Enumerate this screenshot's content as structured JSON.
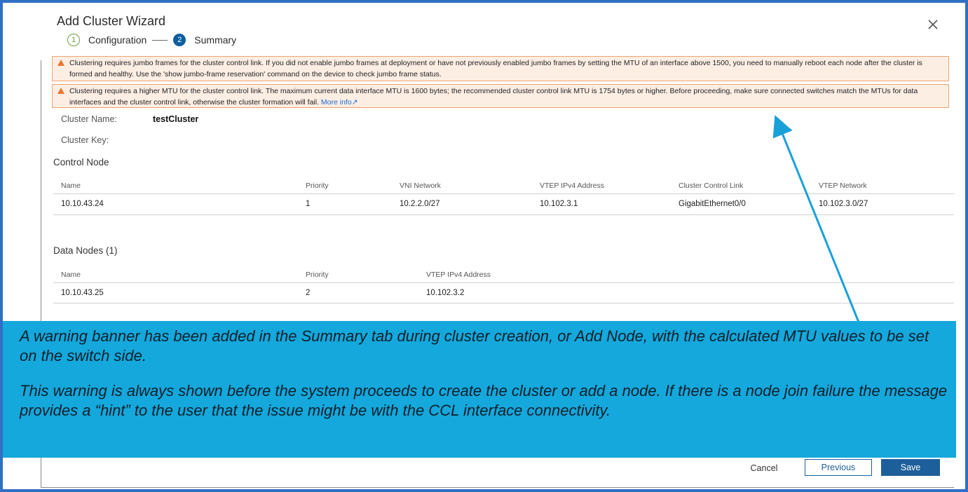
{
  "wizard": {
    "title": "Add Cluster Wizard",
    "steps": [
      {
        "number": "1",
        "label": "Configuration"
      },
      {
        "number": "2",
        "label": "Summary"
      }
    ]
  },
  "warnings": [
    {
      "text": "Clustering requires jumbo frames for the cluster control link. If you did not enable jumbo frames at deployment or have not previously enabled jumbo frames by setting the MTU of an interface above 1500, you need to manually reboot each node after the cluster is formed and healthy. Use the 'show jumbo-frame reservation' command on the device to check jumbo frame status."
    },
    {
      "text": "Clustering requires a higher MTU for the cluster control link. The maximum current data interface MTU is 1600 bytes; the recommended cluster control link MTU is 1754 bytes or higher. Before proceeding, make sure connected switches match the MTUs for data interfaces and the cluster control link, otherwise the cluster formation will fail.",
      "link": "More info"
    }
  ],
  "cluster": {
    "name_label": "Cluster Name:",
    "name_value": "testCluster",
    "key_label": "Cluster Key:"
  },
  "control_node": {
    "title": "Control Node",
    "headers": [
      "Name",
      "Priority",
      "VNI Network",
      "VTEP IPv4 Address",
      "Cluster Control Link",
      "VTEP Network"
    ],
    "row": [
      "10.10.43.24",
      "1",
      "10.2.2.0/27",
      "10.102.3.1",
      "GigabitEthernet0/0",
      "10.102.3.0/27"
    ]
  },
  "data_nodes": {
    "title": "Data Nodes (1)",
    "headers": [
      "Name",
      "Priority",
      "VTEP IPv4 Address"
    ],
    "row": [
      "10.10.43.25",
      "2",
      "10.102.3.2"
    ]
  },
  "callout": {
    "paragraph1": "A warning banner has been added in the Summary tab during cluster creation, or Add Node, with the calculated MTU values to be set on the switch side.",
    "paragraph2": "This warning is always shown before the system proceeds to create the cluster or add a node. If there is a node join failure the message provides a “hint” to the user that the issue might be with the CCL interface connectivity."
  },
  "footer": {
    "cancel_label": "Cancel",
    "previous_label": "Previous",
    "save_label": "Save"
  },
  "colors": {
    "frame_border": "#2f6fc4",
    "warning_bg": "#fdeee4",
    "warning_border": "#f0a36f",
    "callout_bg": "#14a8dc",
    "primary_button": "#1d5f9a",
    "arrow": "#1aa0d8"
  }
}
